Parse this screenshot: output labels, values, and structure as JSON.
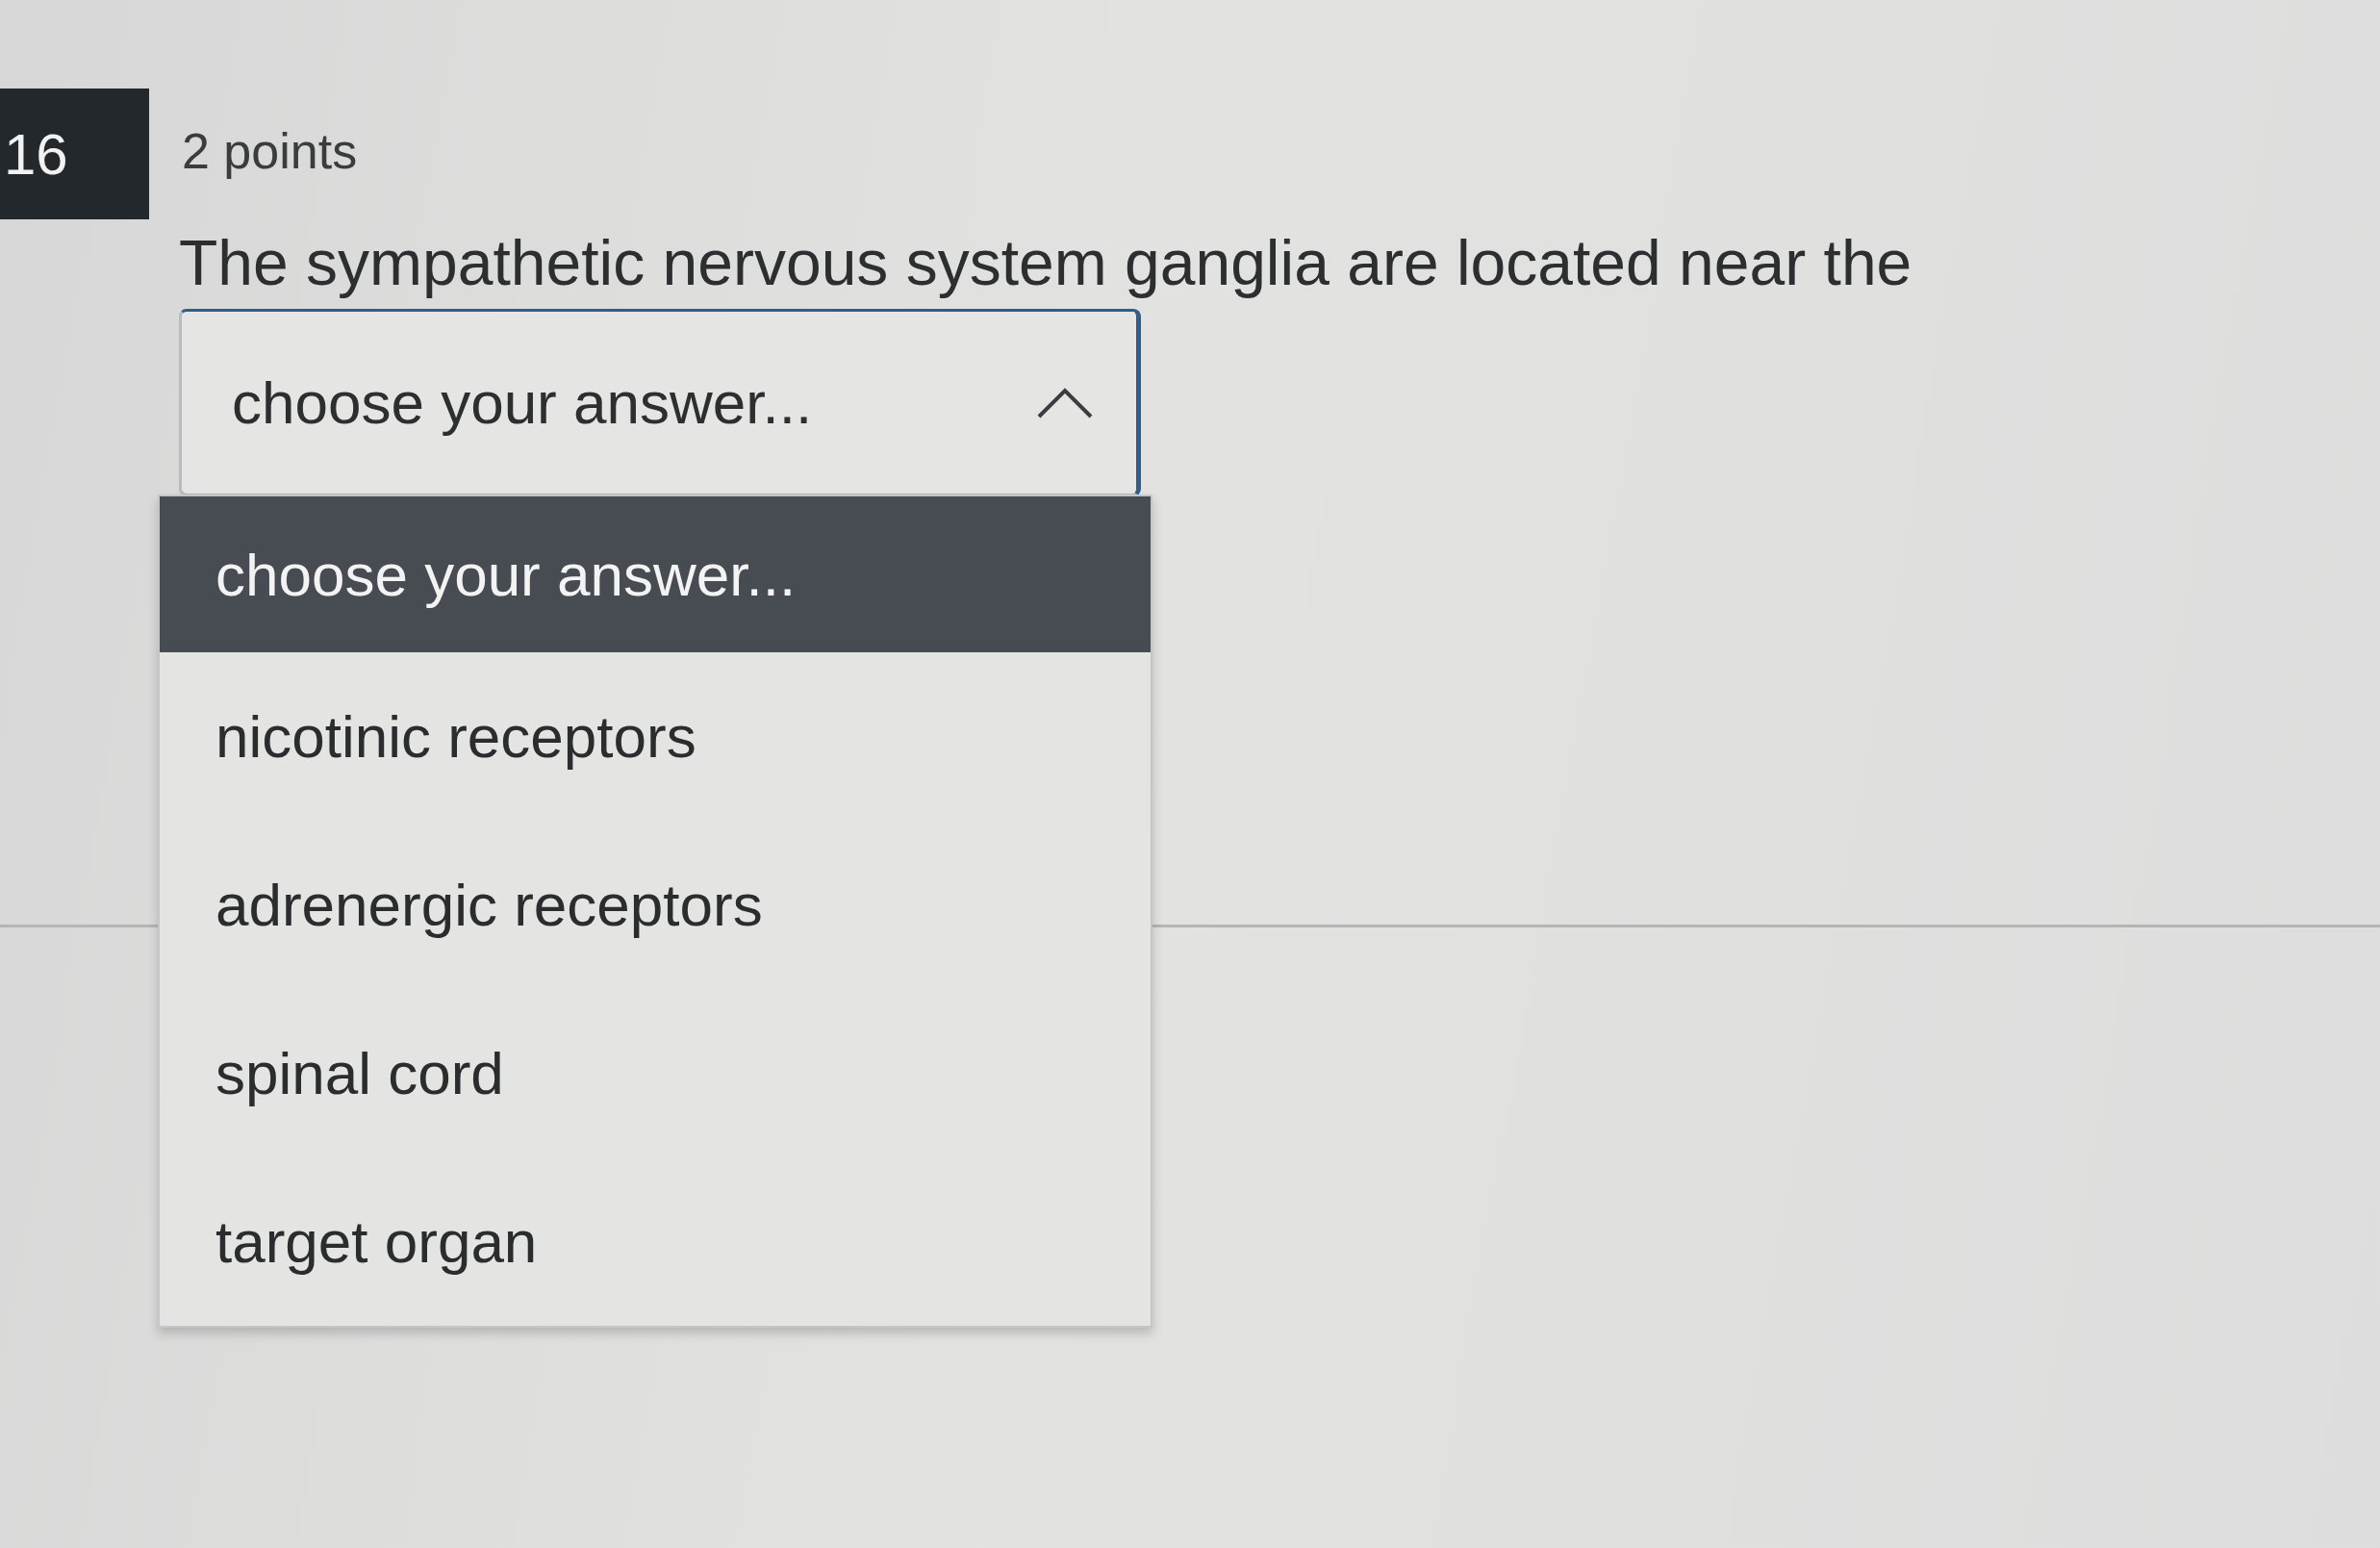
{
  "question": {
    "number": "16",
    "points": "2 points",
    "text": "The sympathetic nervous system ganglia are located near the"
  },
  "select": {
    "value": "choose your answer...",
    "expanded": true,
    "focused": true,
    "options": [
      {
        "label": "choose your answer...",
        "selected": true
      },
      {
        "label": "nicotinic receptors",
        "selected": false
      },
      {
        "label": "adrenergic receptors",
        "selected": false
      },
      {
        "label": "spinal cord",
        "selected": false
      },
      {
        "label": "target organ",
        "selected": false
      }
    ]
  }
}
